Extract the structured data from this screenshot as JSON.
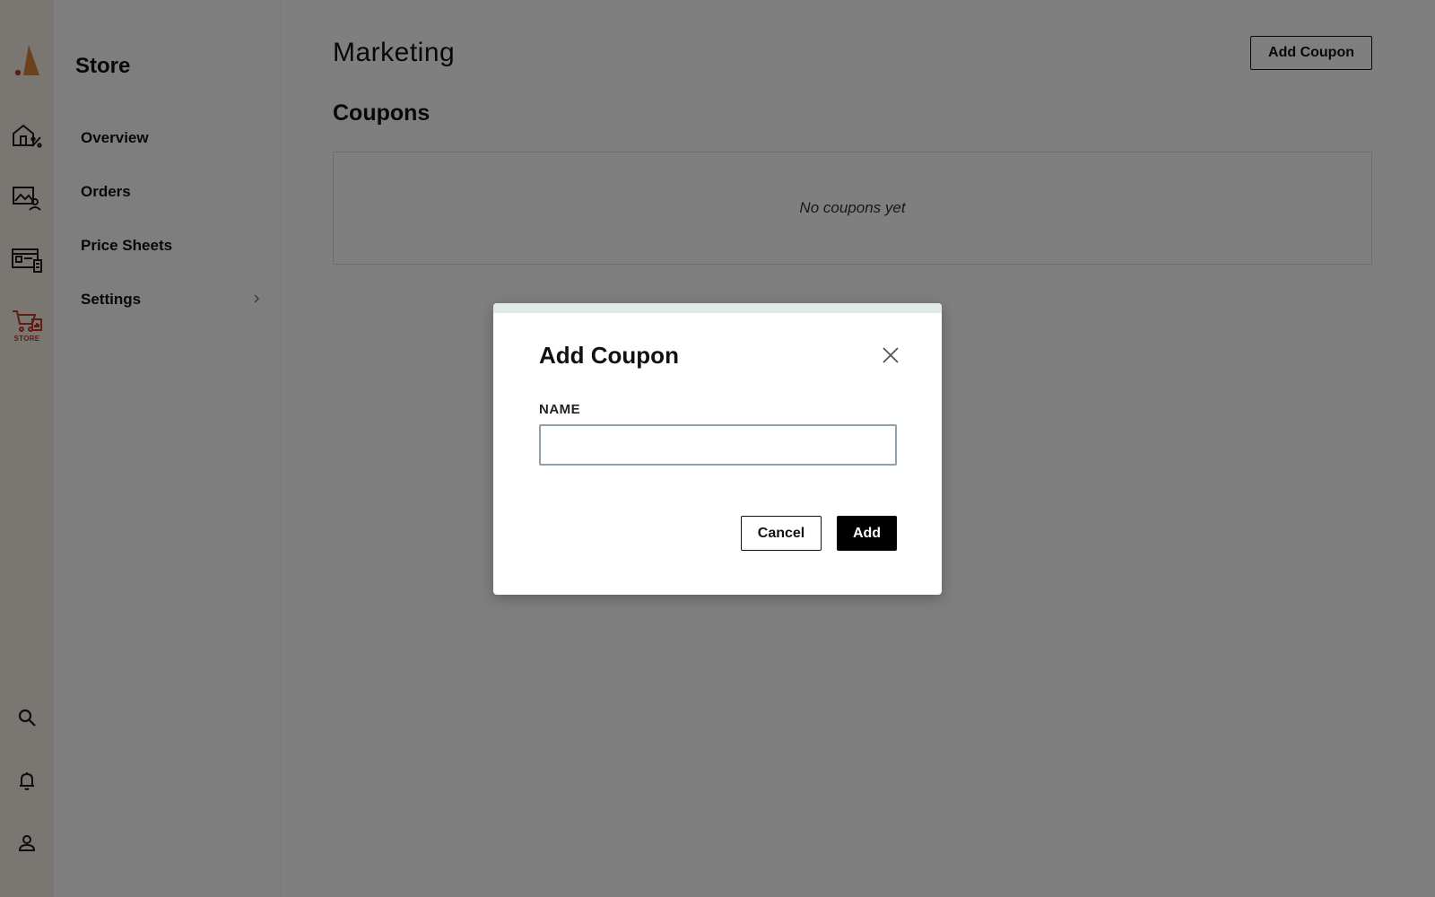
{
  "rail": {
    "items": [
      {
        "icon": "home-percent-icon"
      },
      {
        "icon": "gallery-user-icon"
      },
      {
        "icon": "price-list-icon"
      },
      {
        "icon": "store-cart-icon",
        "label": "STORE",
        "active": true
      }
    ],
    "bottom": [
      {
        "icon": "search-icon"
      },
      {
        "icon": "bell-icon"
      },
      {
        "icon": "user-icon"
      }
    ]
  },
  "sidebar": {
    "title": "Store",
    "items": [
      {
        "label": "Overview"
      },
      {
        "label": "Orders"
      },
      {
        "label": "Price Sheets"
      },
      {
        "label": "Settings",
        "has_submenu": true
      }
    ]
  },
  "main": {
    "title": "Marketing",
    "add_button_label": "Add Coupon",
    "section_title": "Coupons",
    "empty_text": "No coupons yet"
  },
  "modal": {
    "title": "Add Coupon",
    "field_label": "NAME",
    "field_value": "",
    "cancel_label": "Cancel",
    "submit_label": "Add"
  },
  "colors": {
    "brand_accent": "#c0392b",
    "rail_bg": "#f4ede5",
    "overlay": "rgba(0,0,0,0.5)",
    "modal_topbar": "#e3ebe8"
  }
}
